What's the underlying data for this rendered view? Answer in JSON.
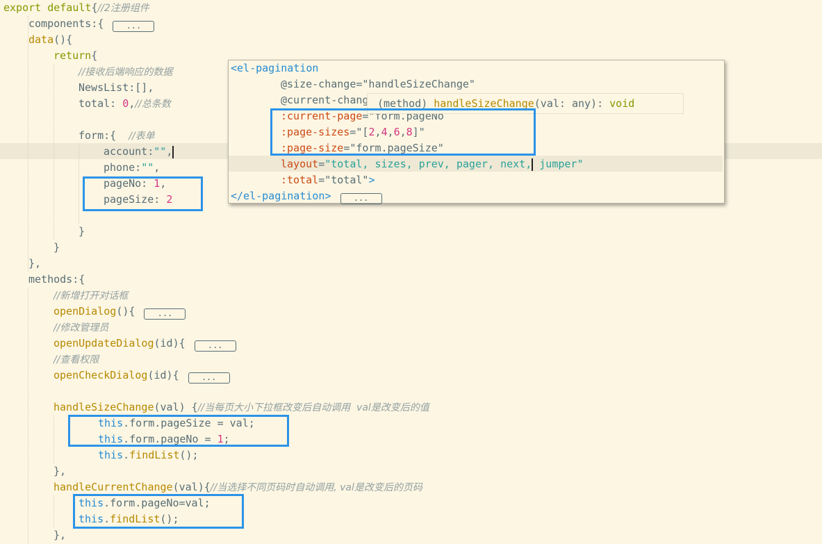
{
  "code": {
    "l1": "export default",
    "l1b": "{",
    "l1c": "//2注册组件",
    "l2": "components:{",
    "fold": "...",
    "l3": "data",
    "l3b": "(){",
    "l4": "return",
    "l4b": "{",
    "l5": "//接收后端响应的数据",
    "l6": "NewsList:[],",
    "l7a": "total: ",
    "l7n": "0",
    "l7b": ",",
    "l7c": "//总条数",
    "l9a": "form:{  ",
    "l9c": "//表单",
    "l10a": "account:",
    "l10s": "\"\"",
    "l10b": ",",
    "l11a": "phone:",
    "l11s": "\"\"",
    "l11b": ",",
    "l12a": "pageNo: ",
    "l12n": "1",
    "l12b": ",",
    "l13a": "pageSize: ",
    "l13n": "2",
    "close1": "}",
    "close2": "}",
    "close3": "},",
    "methods": "methods:{",
    "c1": "//新增打开对话框",
    "m1": "openDialog",
    "m1b": "(){",
    "c2": "//修改管理员",
    "m2": "openUpdateDialog",
    "m2b": "(id){",
    "c3": "//查看权限",
    "m3": "openCheckDialog",
    "m3b": "(id){",
    "m4": "handleSizeChange",
    "m4b": "(val) {",
    "c4": "//当每页大小下拉框改变后自动调用  val是改变后的值",
    "s1this": "this",
    "s1": ".form.pageSize = val;",
    "s2this": "this",
    "s2a": ".form.pageNo = ",
    "s2n": "1",
    "s2b": ";",
    "s3this": "this",
    "s3a": ".",
    "s3f": "findList",
    "s3b": "();",
    "close4": "},",
    "m5": "handleCurrentChange",
    "m5b": "(val){",
    "c5": "//当选择不同页码时自动调用, val是改变后的页码",
    "s4this": "this",
    "s4": ".form.pageNo=val;",
    "s5this": "this",
    "s5a": ".",
    "s5f": "findList",
    "s5b": "();",
    "close5": "},"
  },
  "popup": {
    "p1": "<el-pagination",
    "p2a": "@size-change",
    "p2b": "=",
    "p2s": "\"handleSizeChange\"",
    "p3a": "@current-chang",
    "p4a": ":current-page",
    "p4b": "=",
    "p4s": "\"form.pageNo",
    "p5a": ":page-sizes",
    "p5b": "=",
    "p5s1": "\"[",
    "p5n1": "2",
    "p5c1": ",",
    "p5n2": "4",
    "p5c2": ",",
    "p5n3": "6",
    "p5c3": ",",
    "p5n4": "8",
    "p5s2": "]\"",
    "p6a": ":page-size",
    "p6b": "=",
    "p6s": "\"form.pageSize\"",
    "p7a": "layout",
    "p7b": "=",
    "p7s": "\"total, sizes, prev, pager, next,",
    "p7s2": " jumper\"",
    "p8a": ":total",
    "p8b": "=",
    "p8s": "\"total\"",
    "p8c": ">",
    "p9": "</el-pagination>",
    "fold": "...",
    "tip_kind": "(method) ",
    "tip_fn": "handleSizeChange",
    "tip_args": "(val: any): ",
    "tip_ret": "void"
  },
  "colors": {
    "background": "#fdf6e3",
    "keyword": "#859900",
    "function": "#b58900",
    "string": "#2aa198",
    "number": "#d33682",
    "comment": "#93a1a1",
    "this": "#268bd2",
    "attribute": "#cb4b16",
    "highlight_box": "#2b93e8"
  }
}
